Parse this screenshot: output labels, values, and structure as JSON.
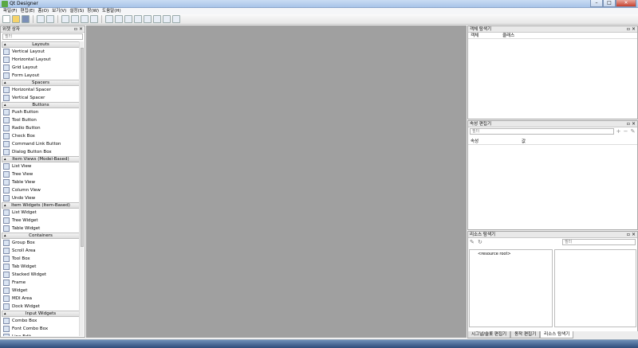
{
  "window": {
    "title": "Qt Designer",
    "minimize": "–",
    "maximize": "□",
    "close": "✕"
  },
  "menu": [
    "파일(F)",
    "편집(E)",
    "폼(O)",
    "보기(V)",
    "설정(S)",
    "창(W)",
    "도움말(H)"
  ],
  "widget_box": {
    "title": "위젯 상자",
    "filter_placeholder": "필터",
    "float": "▫",
    "close": "×",
    "sections": [
      {
        "name": "Layouts",
        "items": [
          "Vertical Layout",
          "Horizontal Layout",
          "Grid Layout",
          "Form Layout"
        ]
      },
      {
        "name": "Spacers",
        "items": [
          "Horizontal Spacer",
          "Vertical Spacer"
        ]
      },
      {
        "name": "Buttons",
        "items": [
          "Push Button",
          "Tool Button",
          "Radio Button",
          "Check Box",
          "Command Link Button",
          "Dialog Button Box"
        ]
      },
      {
        "name": "Item Views (Model-Based)",
        "items": [
          "List View",
          "Tree View",
          "Table View",
          "Column View",
          "Undo View"
        ]
      },
      {
        "name": "Item Widgets (Item-Based)",
        "items": [
          "List Widget",
          "Tree Widget",
          "Table Widget"
        ]
      },
      {
        "name": "Containers",
        "items": [
          "Group Box",
          "Scroll Area",
          "Tool Box",
          "Tab Widget",
          "Stacked Widget",
          "Frame",
          "Widget",
          "MDI Area",
          "Dock Widget"
        ]
      },
      {
        "name": "Input Widgets",
        "items": [
          "Combo Box",
          "Font Combo Box",
          "Line Edit"
        ]
      }
    ]
  },
  "object_inspector": {
    "title": "객체 탐색기",
    "col_object": "객체",
    "col_class": "클래스",
    "float": "▫",
    "close": "×"
  },
  "property_editor": {
    "title": "속성 편집기",
    "filter_placeholder": "필터",
    "col_property": "속성",
    "col_value": "값",
    "float": "▫",
    "close": "×",
    "add": "+",
    "remove": "−",
    "configure": "✎"
  },
  "resource_browser": {
    "title": "리소스 탐색기",
    "filter_placeholder": "필터",
    "root": "<resource root>",
    "float": "▫",
    "close": "×",
    "edit": "✎",
    "reload": "↻"
  },
  "bottom_tabs": [
    "시그널/슬롯 편집기",
    "동작 편집기",
    "리소스 탐색기"
  ]
}
